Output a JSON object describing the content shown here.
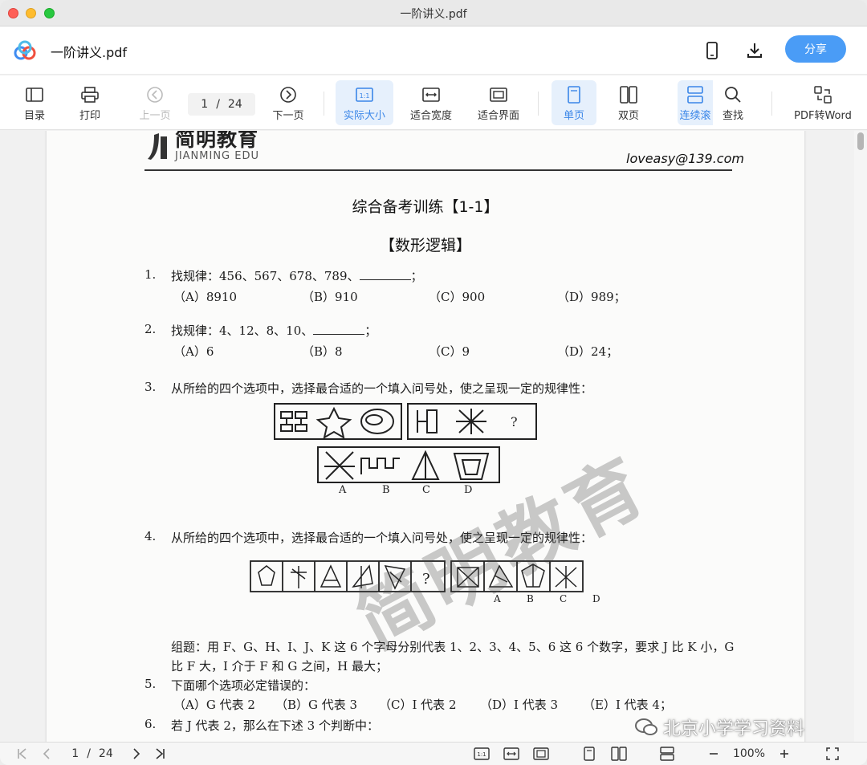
{
  "window": {
    "title": "一阶讲义.pdf"
  },
  "header": {
    "doc_name": "一阶讲义.pdf",
    "share_label": "分享",
    "phone_icon": "phone-icon",
    "download_icon": "download-icon"
  },
  "toolbar": {
    "toc": "目录",
    "print": "打印",
    "prev": "上一页",
    "next": "下一页",
    "page_current": "1",
    "page_sep": "/",
    "page_total": "24",
    "actual_size": "实际大小",
    "fit_width": "适合宽度",
    "fit_page": "适合界面",
    "single": "单页",
    "double": "双页",
    "continuous": "连续滚",
    "search": "查找",
    "pdf_word": "PDF转Word"
  },
  "document": {
    "brand_cn": "简明教育",
    "brand_en": "JIANMING EDU",
    "email": "loveasy@139.com",
    "title": "综合备考训练【1-1】",
    "subtitle": "【数形逻辑】",
    "q1": {
      "num": "1.",
      "text": "找规律：456、567、678、789、",
      "end": "；",
      "opts": [
        "（A）8910",
        "（B）910",
        "（C）900",
        "（D）989；"
      ]
    },
    "q2": {
      "num": "2.",
      "text": "找规律：4、12、8、10、",
      "end": "；",
      "opts": [
        "（A）6",
        "（B）8",
        "（C）9",
        "（D）24；"
      ]
    },
    "q3": {
      "num": "3.",
      "text": "从所给的四个选项中，选择最合适的一个填入问号处，使之呈现一定的规律性：",
      "qmark": "?",
      "labels": [
        "A",
        "B",
        "C",
        "D"
      ]
    },
    "q4": {
      "num": "4.",
      "text": "从所给的四个选项中，选择最合适的一个填入问号处，使之呈现一定的规律性：",
      "qmark": "?",
      "labels": [
        "A",
        "B",
        "C",
        "D"
      ]
    },
    "group_line1": "组题：用 F、G、H、I、J、K 这 6 个字母分别代表 1、2、3、4、5、6 这 6 个数字，要求 J 比 K 小，G",
    "group_line2": "比 F 大，I 介于 F 和 G 之间，H 最大；",
    "q5": {
      "num": "5.",
      "text": "下面哪个选项必定错误的：",
      "opts": [
        "（A）G 代表 2",
        "（B）G 代表 3",
        "（C）I 代表 2",
        "（D）I 代表 3",
        "（E）I 代表 4；"
      ]
    },
    "q6": {
      "num": "6.",
      "text": "若 J 代表 2，那么在下述 3 个判断中："
    },
    "watermark": "简明教育",
    "badge": "北京小学学习资料"
  },
  "bottombar": {
    "page_current": "1",
    "page_sep": "/",
    "page_total": "24",
    "zoom": "100%"
  }
}
